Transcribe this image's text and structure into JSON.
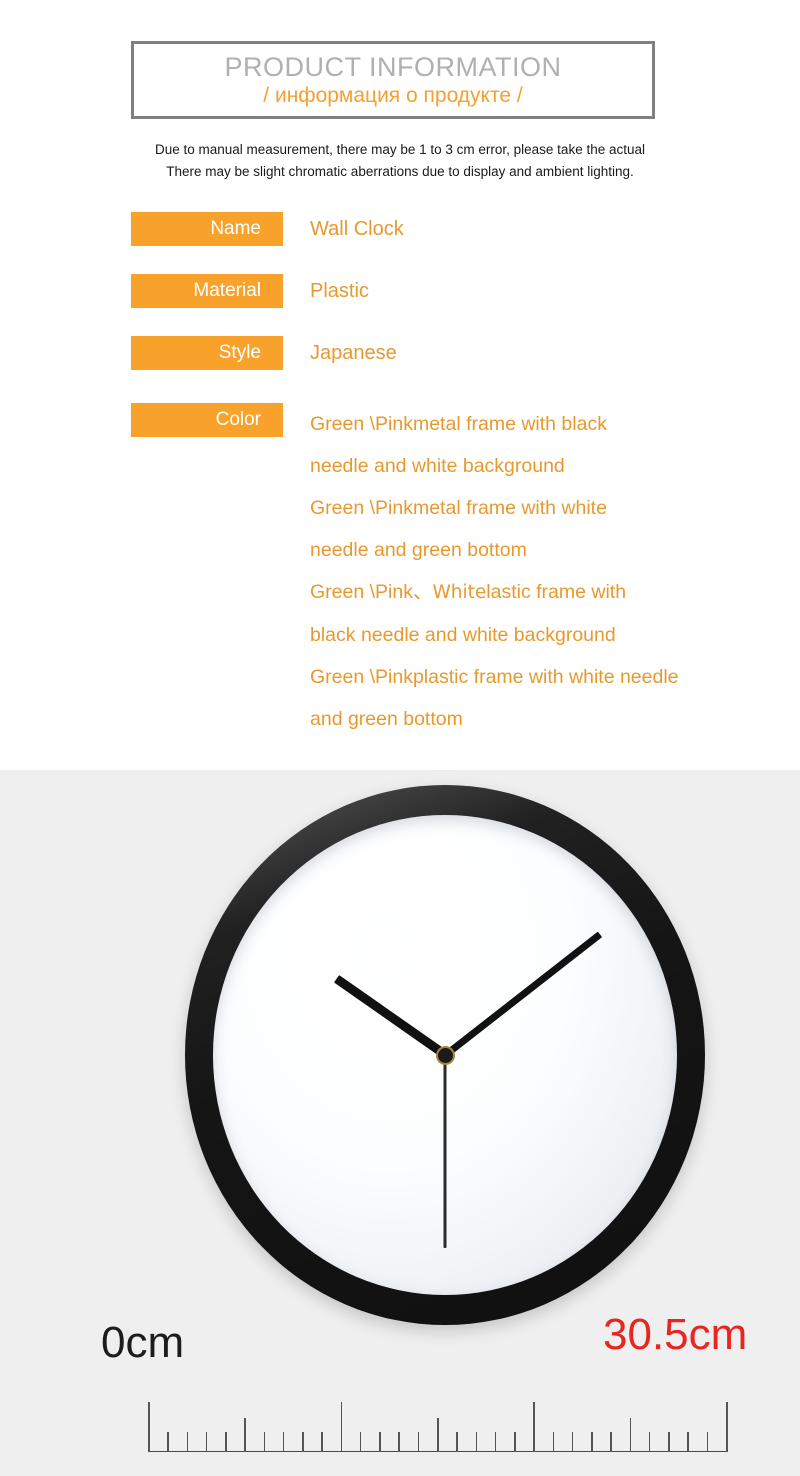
{
  "header": {
    "title_en": "PRODUCT INFORMATION",
    "title_ru": "/  информация о продукте /",
    "border_color": "#808080",
    "title_en_color": "#b0b0b0",
    "title_ru_color": "#f5a030"
  },
  "disclaimer": {
    "line1": "Due to manual measurement, there may be 1 to 3 cm error, please take the actual",
    "line2": "There may be slight chromatic aberrations due to display and ambient lighting."
  },
  "specs": {
    "chip_color": "#f9a22b",
    "value_color": "#e8992e",
    "name": {
      "label": "Name",
      "value": "Wall Clock"
    },
    "material": {
      "label": "Material",
      "value": "Plastic"
    },
    "style": {
      "label": "Style",
      "value": "Japanese"
    },
    "color": {
      "label": "Color",
      "lines": [
        "Green \\Pinkmetal frame with black",
        " needle and white background",
        "Green \\Pinkmetal frame with white",
        "needle and green bottom",
        "Green \\Pinkplastic frame with white needle",
        "and green bottom"
      ],
      "line_white_prefix": "Green \\Pink、",
      "line_white_emphasis": "White",
      "line_white_suffix": "lastic frame with",
      "line_white_next": "black needle and white background"
    }
  },
  "photo": {
    "background_color": "#efefef",
    "product": "wall-clock",
    "frame_color": "#151515",
    "face_color": "#ffffff",
    "hand_color": "#111111",
    "measurements": {
      "start_label": "0cm",
      "start_label_color": "#1c1c1c",
      "end_label": "30.5cm",
      "end_label_color": "#e8251f"
    },
    "ruler": {
      "total_units": 30,
      "major_every": 10,
      "medium_every": 5
    }
  }
}
